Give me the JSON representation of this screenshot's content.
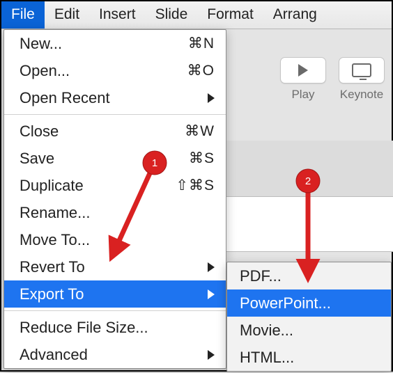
{
  "menubar": {
    "items": [
      "File",
      "Edit",
      "Insert",
      "Slide",
      "Format",
      "Arrang"
    ],
    "active_index": 0
  },
  "toolbar": {
    "play_label": "Play",
    "keynote_label": "Keynote"
  },
  "file_menu": {
    "new_label": "New...",
    "new_shortcut": "⌘N",
    "open_label": "Open...",
    "open_shortcut": "⌘O",
    "open_recent_label": "Open Recent",
    "close_label": "Close",
    "close_shortcut": "⌘W",
    "save_label": "Save",
    "save_shortcut": "⌘S",
    "duplicate_label": "Duplicate",
    "duplicate_shortcut": "⇧⌘S",
    "rename_label": "Rename...",
    "move_to_label": "Move To...",
    "revert_to_label": "Revert To",
    "export_to_label": "Export To",
    "reduce_label": "Reduce File Size...",
    "advanced_label": "Advanced"
  },
  "export_submenu": {
    "pdf_label": "PDF...",
    "powerpoint_label": "PowerPoint...",
    "movie_label": "Movie...",
    "html_label": "HTML..."
  },
  "annotations": {
    "badge1": "1",
    "badge2": "2"
  }
}
